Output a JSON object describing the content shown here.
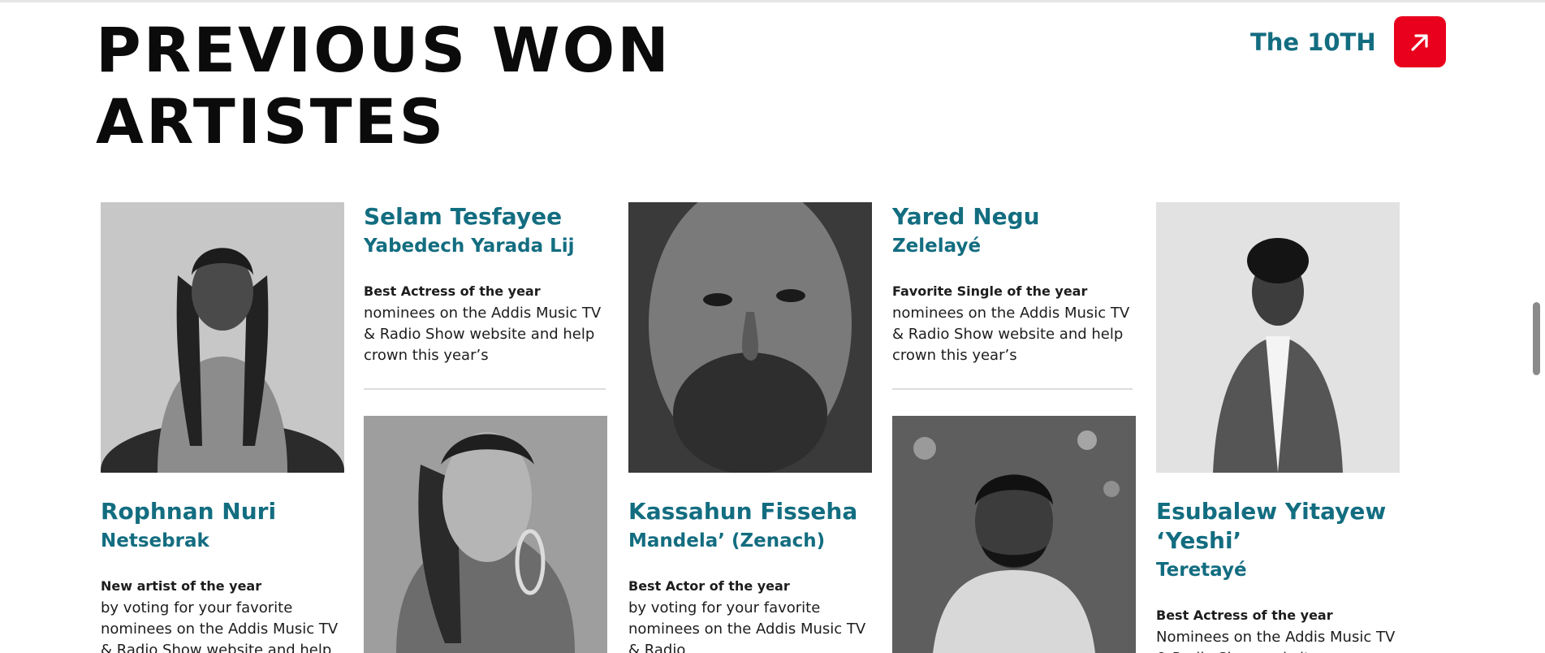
{
  "page": {
    "title": "PREVIOUS WON ARTISTES",
    "cta_label": "The 10TH",
    "cta_icon": "arrow-up-right-icon",
    "accent_color": "#136d80",
    "cta_color": "#e8001c"
  },
  "artists": [
    {
      "name": "Selam Tesfayee",
      "work": "Yabedech Yarada Lij",
      "award": "Best Actress of the year",
      "description": "nominees on the Addis Music TV & Radio Show website and help crown this year’s"
    },
    {
      "name": "Yared Negu",
      "work": "Zelelayé",
      "award": "Favorite Single of the year",
      "description": "nominees on the Addis Music TV & Radio Show website and help crown this year’s"
    },
    {
      "name": "Rophnan Nuri",
      "work": "Netsebrak",
      "award": "New artist of the year",
      "description": "by voting for your favorite nominees on the Addis Music TV & Radio Show website and help crown this"
    },
    {
      "name": "Kassahun Fisseha",
      "work": "Mandela’ (Zenach)",
      "award": "Best Actor of the year",
      "description": "by voting for your favorite nominees on the Addis Music TV & Radio"
    },
    {
      "name": "Esubalew Yitayew ‘Yeshi’",
      "work": "Teretayé",
      "award": "Best Actress of the year",
      "description": "Nominees on the Addis Music TV & Radio Show website"
    }
  ]
}
